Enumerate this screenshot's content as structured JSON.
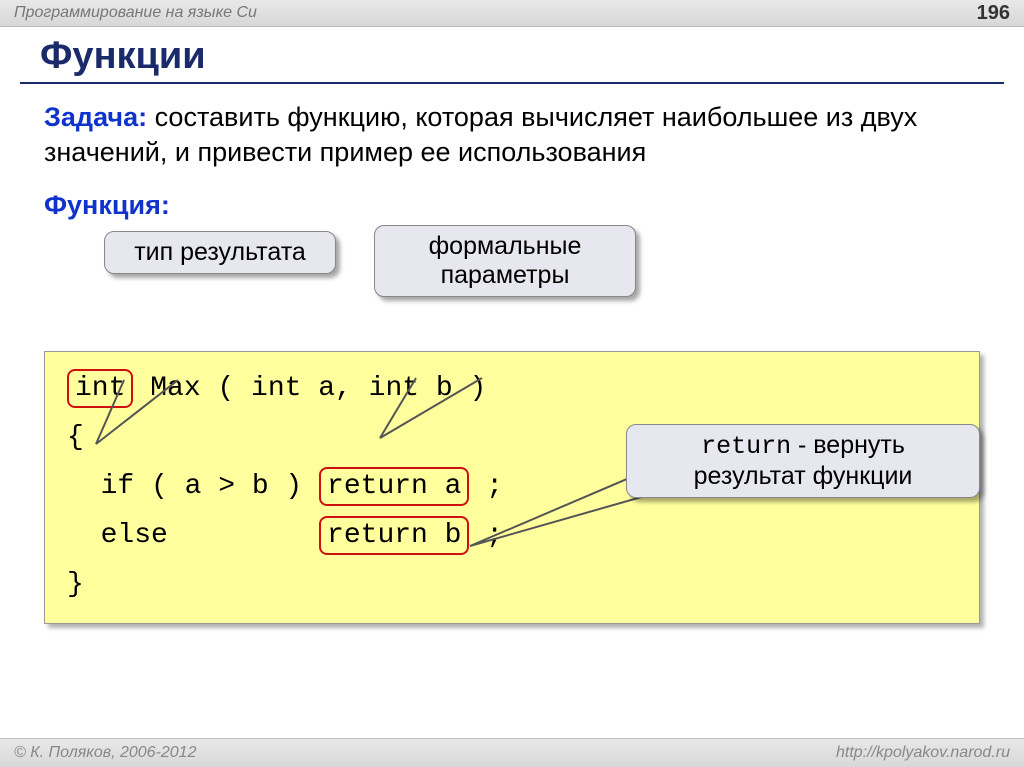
{
  "topbar": {
    "course_title": "Программирование на языке Си",
    "page_number": "196"
  },
  "title": "Функции",
  "task": {
    "label": "Задача:",
    "text": "составить функцию, которая вычисляет наибольшее из двух значений, и привести пример ее использования"
  },
  "function_label": "Функция:",
  "callouts": {
    "result_type": "тип результата",
    "formal_params": "формальные параметры",
    "return_note_mono": "return",
    "return_note_rest": " - вернуть результат функции"
  },
  "code": {
    "kw_int": "int",
    "sig_rest": " Max ( int a, int b )",
    "brace_open": "{",
    "if_part": "  if ( a > b ) ",
    "return_a": "return a",
    "else_part": "  else         ",
    "return_b": "return b",
    "semi_sp": " ;",
    "brace_close": "}"
  },
  "footer": {
    "copyright": "© К. Поляков, 2006-2012",
    "url": "http://kpolyakov.narod.ru"
  }
}
